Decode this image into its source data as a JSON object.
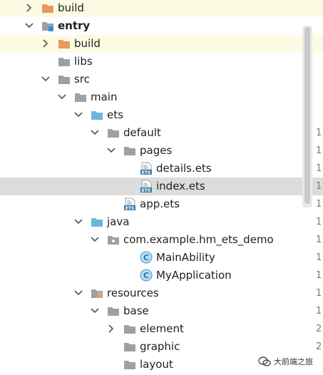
{
  "tree": {
    "rows": [
      {
        "label": "build",
        "depth": 0,
        "chevron": "right",
        "icon": "folder-orange-icon",
        "highlight": "yellow",
        "bold": false
      },
      {
        "label": "entry",
        "depth": 0,
        "chevron": "down",
        "icon": "module-folder-icon",
        "highlight": "",
        "bold": true
      },
      {
        "label": "build",
        "depth": 1,
        "chevron": "right",
        "icon": "folder-orange-icon",
        "highlight": "yellow",
        "bold": false
      },
      {
        "label": "libs",
        "depth": 1,
        "chevron": "",
        "icon": "folder-gray-icon",
        "highlight": "",
        "bold": false
      },
      {
        "label": "src",
        "depth": 1,
        "chevron": "down",
        "icon": "folder-gray-icon",
        "highlight": "",
        "bold": false
      },
      {
        "label": "main",
        "depth": 2,
        "chevron": "down",
        "icon": "folder-gray-icon",
        "highlight": "",
        "bold": false
      },
      {
        "label": "ets",
        "depth": 3,
        "chevron": "down",
        "icon": "folder-blue-icon",
        "highlight": "",
        "bold": false
      },
      {
        "label": "default",
        "depth": 4,
        "chevron": "down",
        "icon": "folder-gray-icon",
        "highlight": "",
        "bold": false
      },
      {
        "label": "pages",
        "depth": 5,
        "chevron": "down",
        "icon": "folder-gray-icon",
        "highlight": "",
        "bold": false
      },
      {
        "label": "details.ets",
        "depth": 6,
        "chevron": "",
        "icon": "ets-file-icon",
        "highlight": "",
        "bold": false
      },
      {
        "label": "index.ets",
        "depth": 6,
        "chevron": "",
        "icon": "ets-file-icon",
        "highlight": "selected",
        "bold": false
      },
      {
        "label": "app.ets",
        "depth": 5,
        "chevron": "",
        "icon": "ets-file-icon",
        "highlight": "",
        "bold": false
      },
      {
        "label": "java",
        "depth": 3,
        "chevron": "down",
        "icon": "folder-blue-icon",
        "highlight": "",
        "bold": false
      },
      {
        "label": "com.example.hm_ets_demo",
        "depth": 4,
        "chevron": "down",
        "icon": "package-folder-icon",
        "highlight": "",
        "bold": false
      },
      {
        "label": "MainAbility",
        "depth": 6,
        "chevron": "",
        "icon": "class-icon",
        "highlight": "",
        "bold": false
      },
      {
        "label": "MyApplication",
        "depth": 6,
        "chevron": "",
        "icon": "class-icon",
        "highlight": "",
        "bold": false
      },
      {
        "label": "resources",
        "depth": 3,
        "chevron": "down",
        "icon": "resources-folder-icon",
        "highlight": "",
        "bold": false
      },
      {
        "label": "base",
        "depth": 4,
        "chevron": "down",
        "icon": "folder-gray-icon",
        "highlight": "",
        "bold": false
      },
      {
        "label": "element",
        "depth": 5,
        "chevron": "right",
        "icon": "folder-gray-icon",
        "highlight": "",
        "bold": false
      },
      {
        "label": "graphic",
        "depth": 5,
        "chevron": "",
        "icon": "folder-gray-icon",
        "highlight": "",
        "bold": false
      },
      {
        "label": "layout",
        "depth": 5,
        "chevron": "",
        "icon": "folder-gray-icon",
        "highlight": "",
        "bold": false
      }
    ]
  },
  "gutter_numbers": [
    {
      "row": 7,
      "text": "1"
    },
    {
      "row": 8,
      "text": "1"
    },
    {
      "row": 9,
      "text": "1"
    },
    {
      "row": 10,
      "text": "1"
    },
    {
      "row": 11,
      "text": "1"
    },
    {
      "row": 12,
      "text": "1"
    },
    {
      "row": 13,
      "text": "1"
    },
    {
      "row": 14,
      "text": "1"
    },
    {
      "row": 15,
      "text": "1"
    },
    {
      "row": 16,
      "text": "1"
    },
    {
      "row": 17,
      "text": "1"
    },
    {
      "row": 18,
      "text": "2"
    },
    {
      "row": 19,
      "text": "2"
    }
  ],
  "watermark": {
    "text": "大前端之旅"
  },
  "colors": {
    "folder_orange": "#e89a5c",
    "folder_gray": "#9aa1a8",
    "folder_blue": "#6cb6dc",
    "ets_blue": "#3f7cac",
    "class_blue": "#3d9bd6"
  }
}
